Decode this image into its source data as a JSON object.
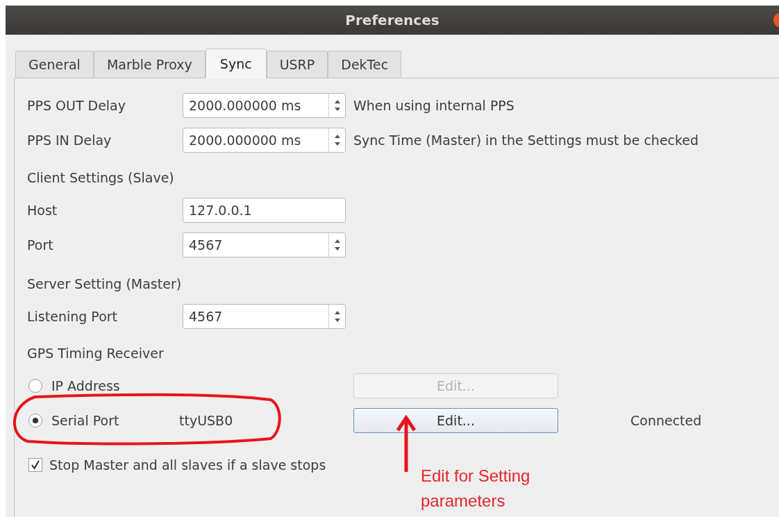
{
  "window": {
    "title": "Preferences"
  },
  "tabs": [
    {
      "label": "General",
      "selected": false
    },
    {
      "label": "Marble Proxy",
      "selected": false
    },
    {
      "label": "Sync",
      "selected": true
    },
    {
      "label": "USRP",
      "selected": false
    },
    {
      "label": "DekTec",
      "selected": false
    }
  ],
  "delays": [
    {
      "label": "PPS OUT Delay",
      "value": "2000.000000 ms",
      "note": "When using internal PPS"
    },
    {
      "label": "PPS IN Delay",
      "value": "2000.000000 ms",
      "note": "Sync Time (Master) in the Settings must be checked"
    }
  ],
  "client": {
    "heading": "Client Settings (Slave)",
    "fields": [
      {
        "label": "Host",
        "value": "127.0.0.1",
        "kind": "text"
      },
      {
        "label": "Port",
        "value": "4567",
        "kind": "spinbox"
      }
    ]
  },
  "server": {
    "heading": "Server Setting (Master)",
    "fields": [
      {
        "label": "Listening Port",
        "value": "4567",
        "kind": "spinbox"
      }
    ]
  },
  "gps": {
    "heading": "GPS Timing Receiver",
    "options": [
      {
        "label": "IP Address",
        "selected": false,
        "button": {
          "label": "Edit...",
          "disabled": true
        }
      },
      {
        "label": "Serial Port",
        "selected": true,
        "detail": "ttyUSB0",
        "button": {
          "label": "Edit...",
          "disabled": false
        },
        "status": "Connected"
      }
    ]
  },
  "stop_option": {
    "label": "Stop Master and all slaves if a slave stops",
    "checked": true
  },
  "annotation": {
    "lines": [
      "Edit for Setting",
      "parameters"
    ]
  }
}
